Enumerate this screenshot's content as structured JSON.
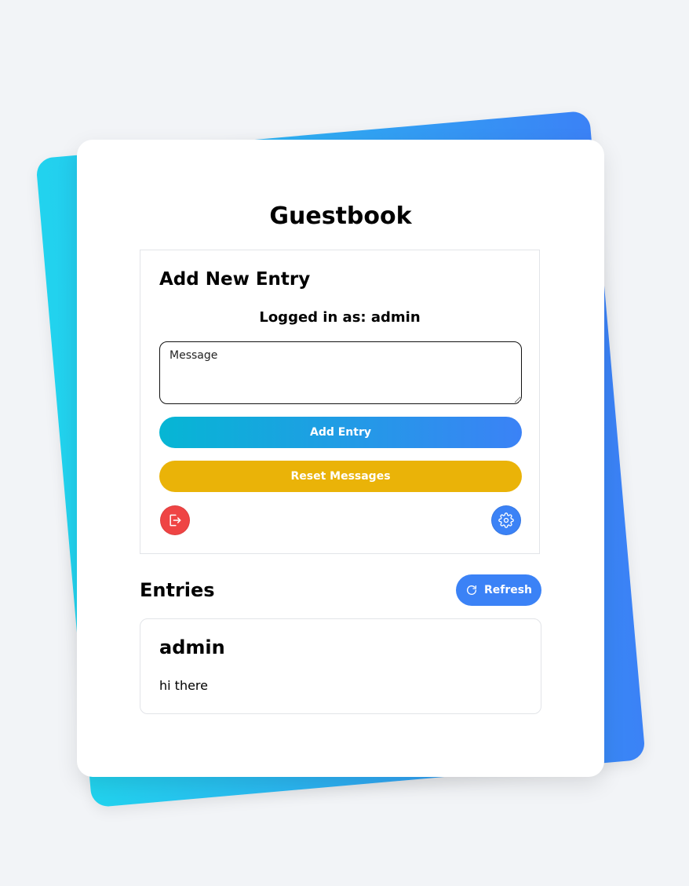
{
  "page": {
    "title": "Guestbook"
  },
  "form": {
    "heading": "Add New Entry",
    "logged_in_text": "Logged in as: admin",
    "message_placeholder": "Message",
    "message_value": "",
    "add_label": "Add Entry",
    "reset_label": "Reset Messages",
    "logout_icon": "logout-icon",
    "settings_icon": "gear-icon"
  },
  "entries": {
    "heading": "Entries",
    "refresh_label": "Refresh",
    "refresh_icon": "refresh-icon",
    "items": [
      {
        "author": "admin",
        "message": "hi there"
      }
    ]
  },
  "colors": {
    "background": "#f2f4f7",
    "accent_gradient_start": "#22d3ee",
    "accent_gradient_end": "#3b82f6",
    "primary": "#3b82f6",
    "warning": "#eab308",
    "danger": "#ef4444"
  }
}
